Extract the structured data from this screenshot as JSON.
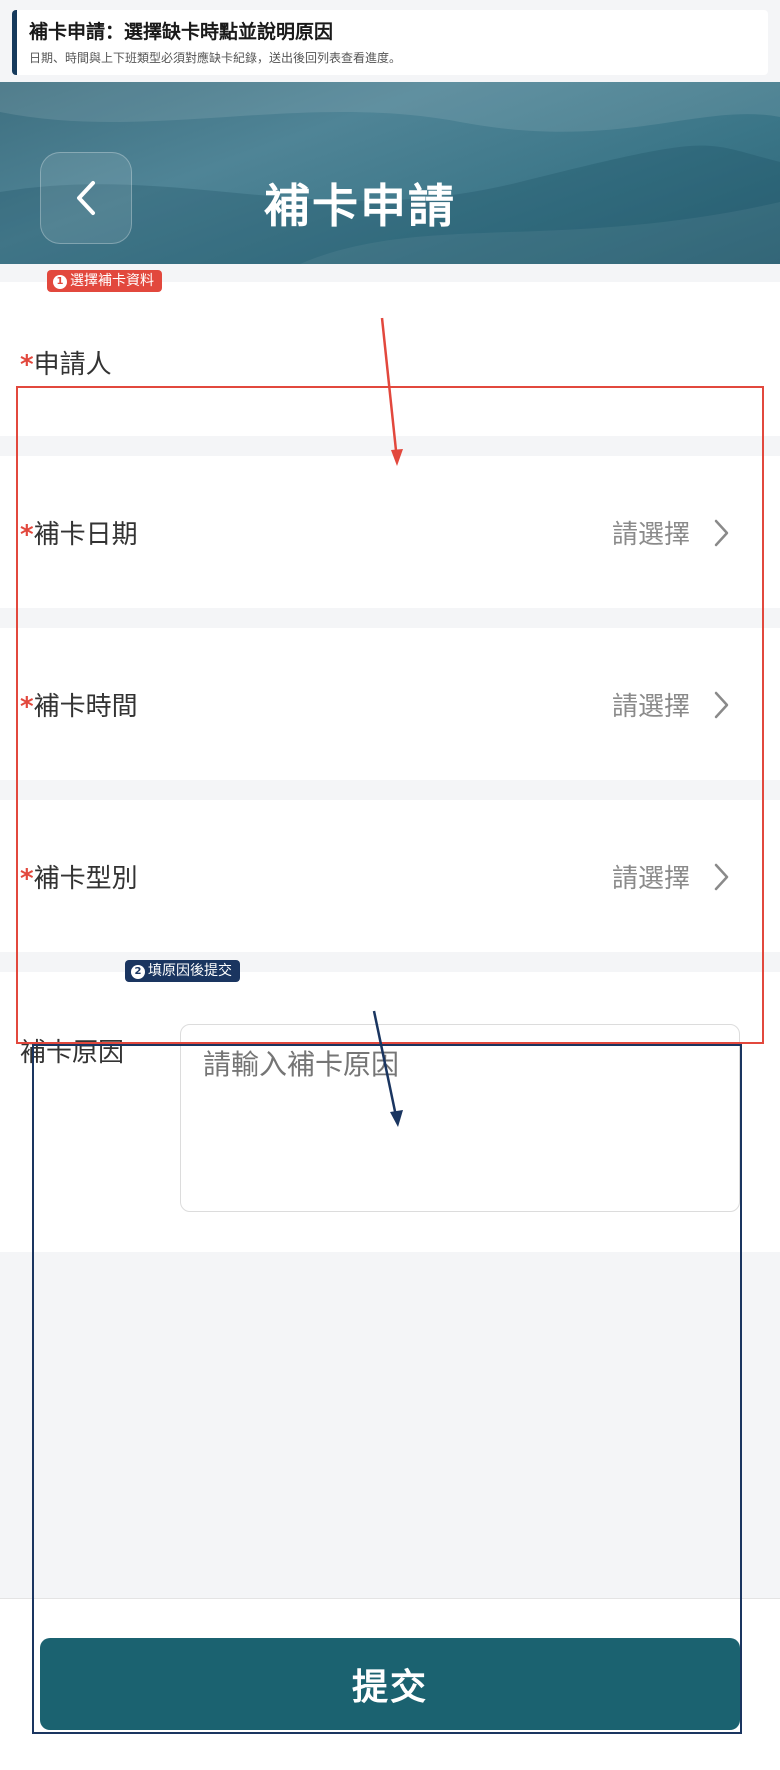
{
  "caption": {
    "title": "補卡申請：選擇缺卡時點並說明原因",
    "subtitle": "日期、時間與上下班類型必須對應缺卡紀錄，送出後回列表查看進度。"
  },
  "header": {
    "title": "補卡申請",
    "back_icon": "chevron-left-icon"
  },
  "form": {
    "applicant": {
      "required_mark": "*",
      "label": "申請人",
      "value": ""
    },
    "date": {
      "required_mark": "*",
      "label": "補卡日期",
      "value": "請選擇",
      "icon": "chevron-right-icon"
    },
    "time": {
      "required_mark": "*",
      "label": "補卡時間",
      "value": "請選擇",
      "icon": "chevron-right-icon"
    },
    "type": {
      "required_mark": "*",
      "label": "補卡型別",
      "value": "請選擇",
      "icon": "chevron-right-icon"
    },
    "reason": {
      "label": "補卡原因",
      "placeholder": "請輸入補卡原因",
      "value": ""
    }
  },
  "footer": {
    "submit_label": "提交"
  },
  "annotations": [
    {
      "num": "1",
      "label": "選擇補卡資料",
      "color": "#e2483d"
    },
    {
      "num": "2",
      "label": "填原因後提交",
      "color": "#1a3560"
    }
  ],
  "colors": {
    "header": "#3e7384",
    "submit": "#1b6270",
    "required": "#e2483d",
    "annotation_1": "#e2483d",
    "annotation_2": "#1a3560"
  }
}
